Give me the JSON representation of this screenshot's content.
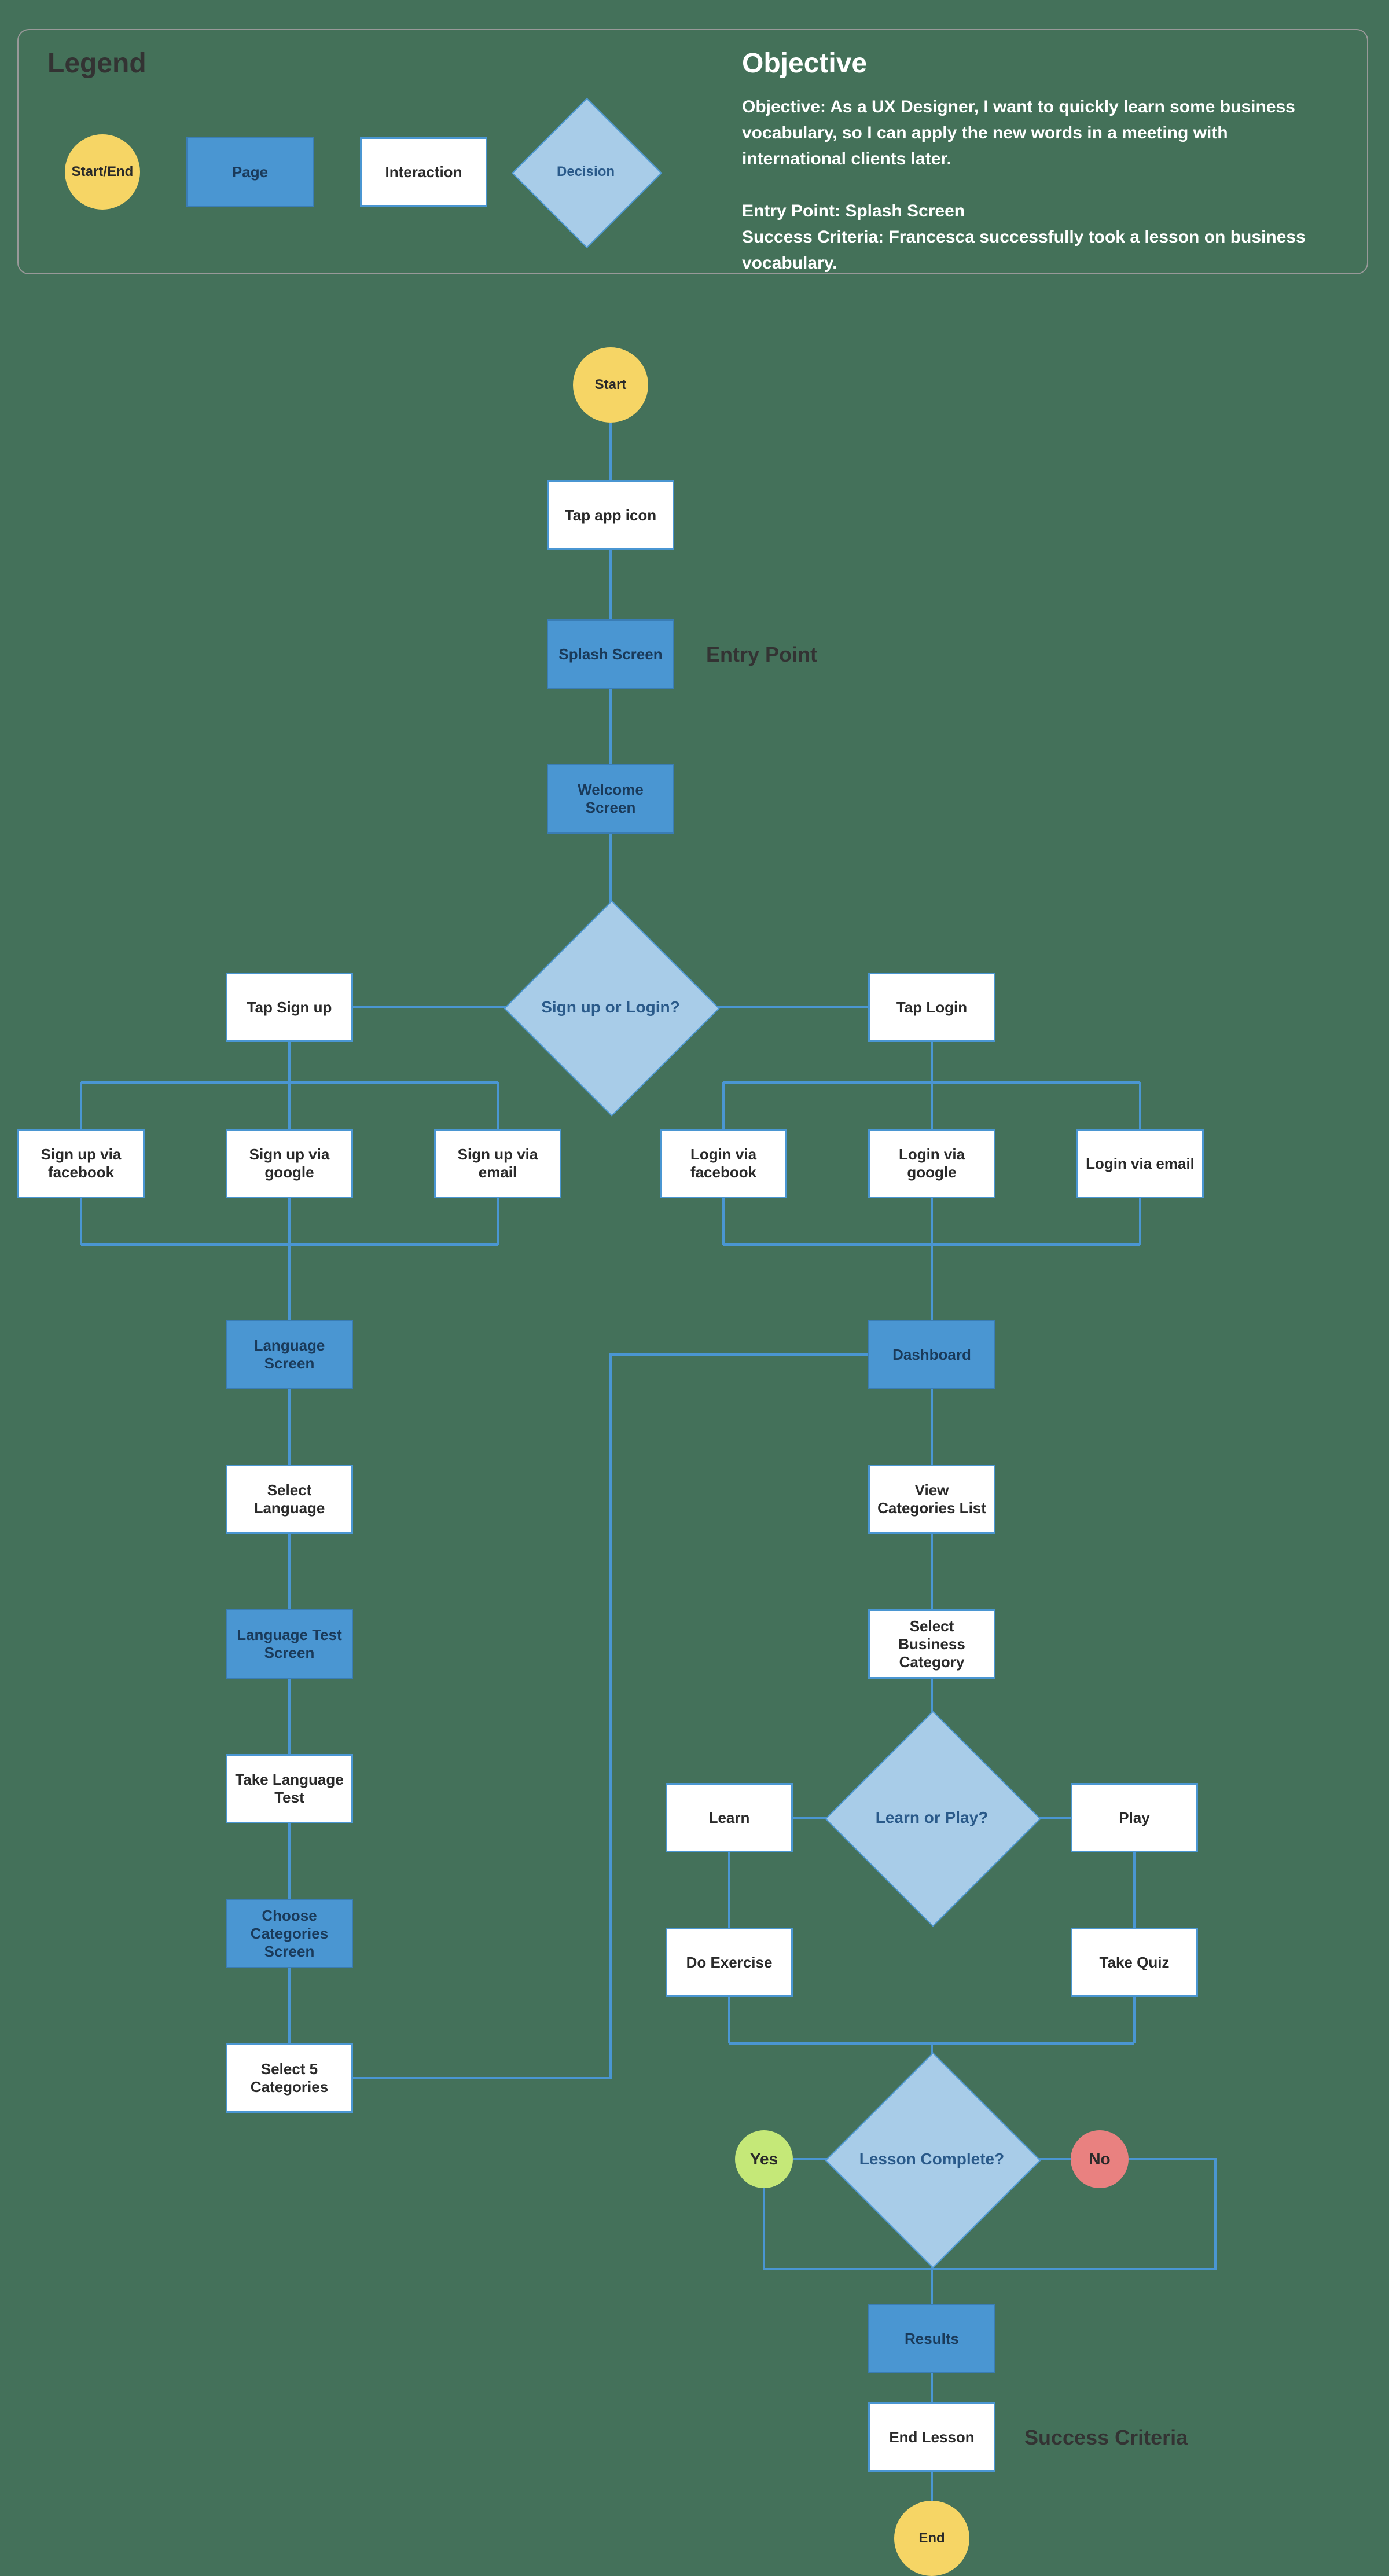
{
  "legend": {
    "title": "Legend",
    "start_end": "Start/End",
    "page": "Page",
    "interaction": "Interaction",
    "decision": "Decision"
  },
  "objective": {
    "title": "Objective",
    "line1": "Objective:  As a  UX Designer, I want to quickly learn some business vocabulary, so I can apply the new words in a meeting with international clients later.",
    "line2": "Entry Point: Splash Screen",
    "line3": "Success Criteria: Francesca successfully took a lesson on business vocabulary."
  },
  "annotations": {
    "entry_point": "Entry Point",
    "success_criteria": "Success Criteria"
  },
  "nodes": {
    "start": "Start",
    "tap_app_icon": "Tap app icon",
    "splash_screen": "Splash Screen",
    "welcome_screen": "Welcome Screen",
    "signup_or_login": "Sign up or Login?",
    "tap_signup": "Tap Sign up",
    "tap_login": "Tap Login",
    "signup_facebook": "Sign up via facebook",
    "signup_google": "Sign up via google",
    "signup_email": "Sign up via email",
    "login_facebook": "Login via facebook",
    "login_google": "Login via google",
    "login_email": "Login via email",
    "language_screen": "Language Screen",
    "dashboard": "Dashboard",
    "select_language": "Select Language",
    "language_test_screen": "Language Test Screen",
    "take_language_test": "Take Language Test",
    "choose_categories_screen": "Choose Categories Screen",
    "select_5_categories": "Select 5 Categories",
    "view_categories_list": "View Categories List",
    "select_business_category": "Select Business Category",
    "learn_or_play": "Learn or Play?",
    "learn": "Learn",
    "play": "Play",
    "do_exercise": "Do Exercise",
    "take_quiz": "Take Quiz",
    "lesson_complete": "Lesson Complete?",
    "yes": "Yes",
    "no": "No",
    "results": "Results",
    "end_lesson": "End Lesson",
    "end": "End"
  }
}
